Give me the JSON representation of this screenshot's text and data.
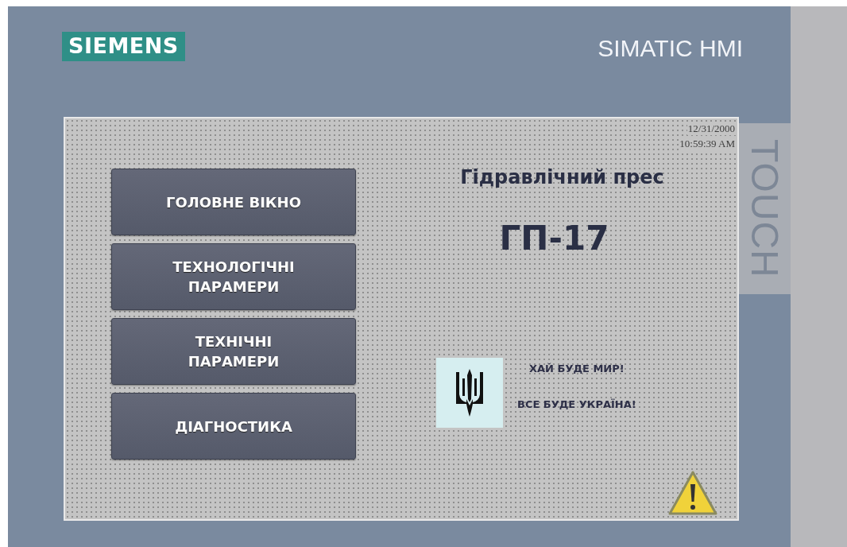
{
  "panel": {
    "logo": "SIEMENS",
    "product": "SIMATIC HMI",
    "label": "TOUCH"
  },
  "screen": {
    "date": "12/31/2000",
    "time": "10:59:39 AM",
    "nav_buttons": [
      "ГОЛОВНЕ ВІКНО",
      "ТЕХНОЛОГІЧНІ ПАРАМЕРИ",
      "ТЕХНІЧНІ ПАРАМЕРИ",
      "ДІАГНОСТИКА"
    ],
    "title": "Гідравлічний прес",
    "machine_id": "ГП-17",
    "messages": [
      "ХАЙ БУДЕ МИР!",
      "ВСЕ БУДЕ УКРАЇНА!"
    ]
  }
}
